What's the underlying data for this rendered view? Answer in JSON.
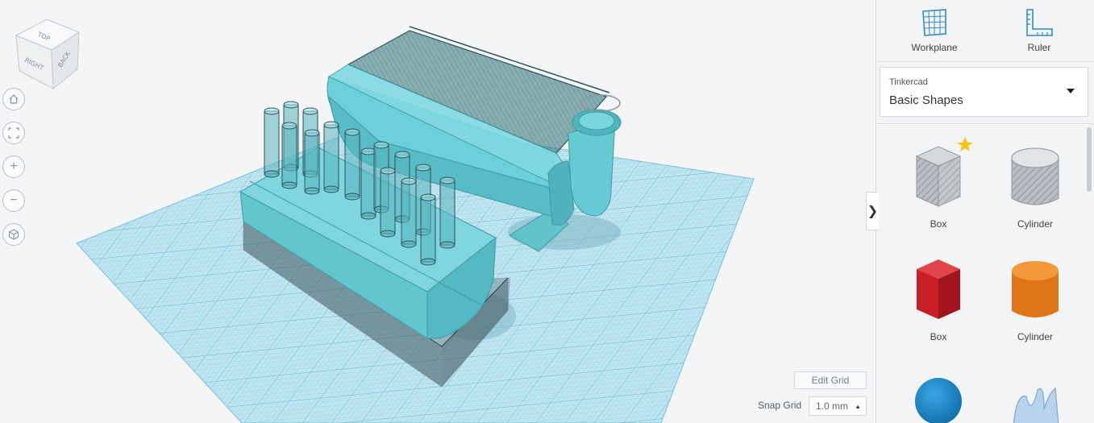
{
  "toolbar": {
    "workplane_label": "Workplane",
    "ruler_label": "Ruler"
  },
  "library": {
    "source": "Tinkercad",
    "selected": "Basic Shapes"
  },
  "shapes": [
    {
      "label": "Box",
      "icon": "box-hole-icon",
      "favorite": true
    },
    {
      "label": "Cylinder",
      "icon": "cylinder-hole-icon"
    },
    {
      "label": "Box",
      "icon": "box-solid-icon",
      "color": "#d8222a"
    },
    {
      "label": "Cylinder",
      "icon": "cylinder-solid-icon",
      "color": "#e8781e"
    },
    {
      "label": "",
      "icon": "sphere-icon",
      "color": "#1f8fd6"
    },
    {
      "label": "",
      "icon": "scribble-icon",
      "color": "#a8c7e6"
    }
  ],
  "view_cube": {
    "top": "TOP",
    "right": "RIGHT",
    "back": "BACK"
  },
  "nav": {
    "home": "home-icon",
    "fit": "fit-view-icon",
    "zoom_in": "+",
    "zoom_out": "−",
    "ortho": "perspective-icon"
  },
  "grid": {
    "edit_label": "Edit Grid",
    "snap_label": "Snap Grid",
    "snap_value": "1.0 mm",
    "snap_arrow": "▲"
  },
  "panel": {
    "collapse_glyph": "❯"
  },
  "colors": {
    "model_teal": "#6ccfd9",
    "workplane_blue": "#a9dcea",
    "hole_gray": "#9aa3ab"
  }
}
